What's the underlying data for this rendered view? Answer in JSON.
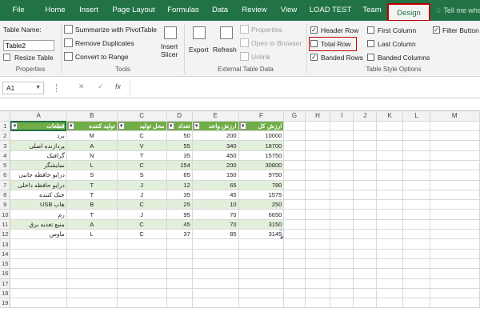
{
  "tabs": [
    "File",
    "Home",
    "Insert",
    "Page Layout",
    "Formulas",
    "Data",
    "Review",
    "View",
    "LOAD TEST",
    "Team",
    "Design"
  ],
  "tell_me": "Tell me wha",
  "properties": {
    "table_name_label": "Table Name:",
    "table_name_value": "Table2",
    "resize_label": "Resize Table",
    "group": "Properties"
  },
  "tools": {
    "summarize": "Summarize with PivotTable",
    "remove_dup": "Remove Duplicates",
    "convert": "Convert to Range",
    "insert_slicer_1": "Insert",
    "insert_slicer_2": "Slicer",
    "group": "Tools"
  },
  "external": {
    "export": "Export",
    "refresh": "Refresh",
    "properties": "Properties",
    "open_browser": "Open in Browser",
    "unlink": "Unlink",
    "group": "External Table Data"
  },
  "style_options": {
    "header_row": "Header Row",
    "total_row": "Total Row",
    "banded_rows": "Banded Rows",
    "first_column": "First Column",
    "last_column": "Last Column",
    "banded_columns": "Banded Columns",
    "filter_button": "Filter Button",
    "group": "Table Style Options"
  },
  "formula_bar": {
    "name_box": "A1",
    "cancel": "✕",
    "enter": "✓",
    "fx": "fx"
  },
  "columns": [
    "A",
    "B",
    "C",
    "D",
    "E",
    "F",
    "G",
    "H",
    "I",
    "J",
    "K",
    "L",
    "M"
  ],
  "rows": [
    "1",
    "2",
    "3",
    "4",
    "5",
    "6",
    "7",
    "8",
    "9",
    "10",
    "11",
    "12",
    "13",
    "14",
    "15",
    "16",
    "17",
    "18",
    "19",
    "20"
  ],
  "table": {
    "headers": [
      "قطعات",
      "تولید کننده",
      "محل تولید",
      "تعداد",
      "ارزش واحد",
      "ارزش کل"
    ],
    "rows": [
      [
        "برد",
        "M",
        "C",
        "50",
        "200",
        "10000"
      ],
      [
        "پردازنده اصلی",
        "A",
        "V",
        "55",
        "340",
        "18700"
      ],
      [
        "گرافیک",
        "N",
        "T",
        "35",
        "450",
        "15750"
      ],
      [
        "نمایشگر",
        "L",
        "C",
        "154",
        "200",
        "30800"
      ],
      [
        "درایو حافظه جانبی",
        "S",
        "S",
        "65",
        "150",
        "9750"
      ],
      [
        "درایو حافظه داخلی",
        "T",
        "J",
        "12",
        "65",
        "780"
      ],
      [
        "خنک کننده",
        "T",
        "J",
        "35",
        "45",
        "1575"
      ],
      [
        "هاب USB",
        "B",
        "C",
        "25",
        "10",
        "250"
      ],
      [
        "رم",
        "T",
        "J",
        "95",
        "70",
        "6650"
      ],
      [
        "منبع تغذیه برق",
        "A",
        "C",
        "45",
        "70",
        "3150"
      ],
      [
        "ماوس",
        "L",
        "C",
        "37",
        "85",
        "3145"
      ]
    ]
  },
  "colors": {
    "ribbon_green": "#217346",
    "table_header": "#70ad47",
    "band": "#e2efda",
    "highlight": "#c00000"
  }
}
